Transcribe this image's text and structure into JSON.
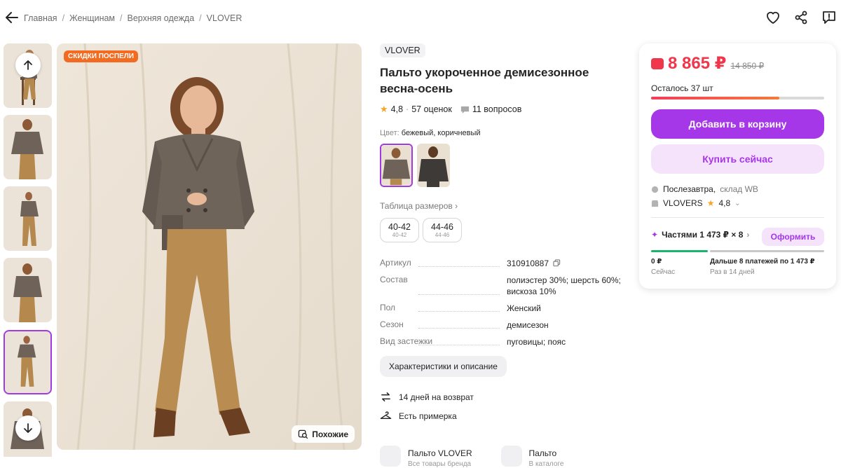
{
  "breadcrumbs": [
    "Главная",
    "Женщинам",
    "Верхняя одежда",
    "VLOVER"
  ],
  "gallery": {
    "badge": "СКИДКИ ПОСПЕЛИ",
    "similar_label": "Похожие"
  },
  "product": {
    "brand": "VLOVER",
    "title": "Пальто укороченное демисезонное весна-осень",
    "rating": "4,8",
    "reviews": "57 оценок",
    "questions": "11 вопросов",
    "color_label": "Цвет:",
    "color_value": "бежевый, коричневый",
    "size_table_link": "Таблица размеров",
    "sizes": [
      {
        "main": "40-42",
        "sub": "40-42"
      },
      {
        "main": "44-46",
        "sub": "44-46"
      }
    ],
    "specs": [
      {
        "key": "Артикул",
        "value": "310910887"
      },
      {
        "key": "Состав",
        "value": "полиэстер 30%; шерсть 60%; вискоза 10%"
      },
      {
        "key": "Пол",
        "value": "Женский"
      },
      {
        "key": "Сезон",
        "value": "демисезон"
      },
      {
        "key": "Вид застежки",
        "value": "пуговицы; пояс"
      }
    ],
    "char_button": "Характеристики и описание",
    "features": [
      "14 дней на возврат",
      "Есть примерка"
    ],
    "bottom_cards": [
      {
        "title": "Пальто VLOVER",
        "sub": "Все товары бренда"
      },
      {
        "title": "Пальто",
        "sub": "В каталоге"
      }
    ]
  },
  "buy": {
    "price": "8 865 ₽",
    "old_price": "14 850 ₽",
    "stock": "Осталось 37 шт",
    "stock_fraction": 0.74,
    "add_to_cart": "Добавить в корзину",
    "buy_now": "Купить сейчас",
    "delivery": "Послезавтра,",
    "warehouse": "склад WB",
    "seller": "VLOVERS",
    "seller_rating": "4,8",
    "installments": "Частями 1 473 ₽ × 8",
    "checkout": "Оформить",
    "plan_now_amount": "0 ₽",
    "plan_now_label": "Сейчас",
    "plan_next_amount": "Дальше 8 платежей по 1 473 ₽",
    "plan_next_label": "Раз в 14 дней"
  },
  "colors": {
    "accent": "#a537e8",
    "price": "#f0364a",
    "badge": "#f26b21"
  }
}
